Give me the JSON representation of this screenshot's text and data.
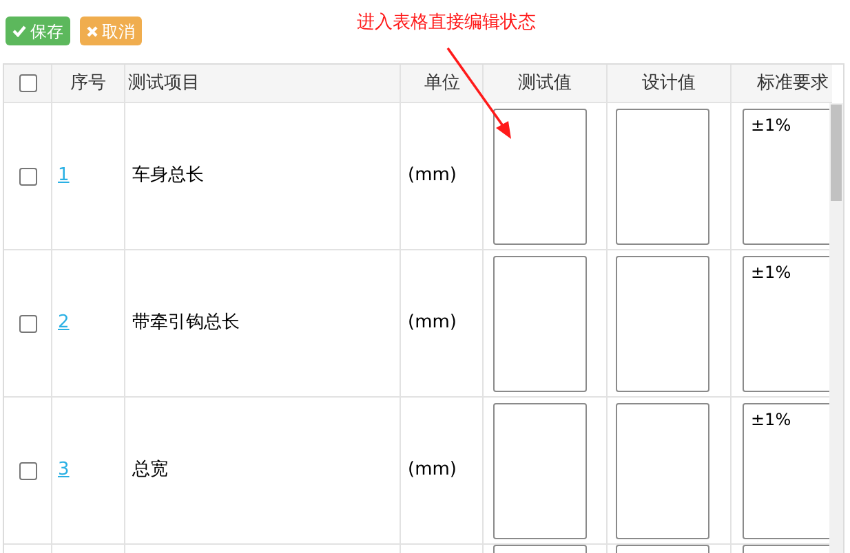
{
  "toolbar": {
    "buttons": [
      {
        "kind": "save",
        "label": "保存"
      },
      {
        "kind": "cancel",
        "label": "取消"
      }
    ]
  },
  "annotation": "进入表格直接编辑状态",
  "table": {
    "select_all": {
      "checked": false
    },
    "columns": [
      "序号",
      "测试项目",
      "单位",
      "测试值",
      "设计值",
      "标准要求"
    ],
    "rows": [
      {
        "checked": false,
        "index": "1",
        "item": "车身总长",
        "unit": "(mm)",
        "standard": "±1%"
      },
      {
        "checked": false,
        "index": "2",
        "item": "带牵引钩总长",
        "unit": "(mm)",
        "standard": "±1%"
      },
      {
        "checked": false,
        "index": "3",
        "item": "总宽",
        "unit": "(mm)",
        "standard": "±1%"
      }
    ]
  }
}
